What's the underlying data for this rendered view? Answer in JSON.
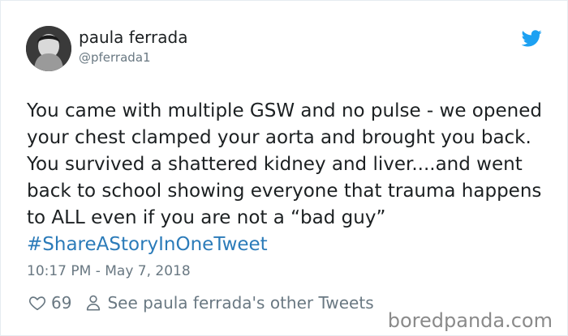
{
  "author": {
    "name": "paula ferrada",
    "handle": "@pferrada1"
  },
  "tweet": {
    "text": "You came with multiple GSW and no pulse - we opened your chest clamped your aorta and brought you back. You survived a shattered kidney and liver....and went back to school showing everyone that trauma happens to ALL even if you are not a “bad guy” ",
    "hashtag": "#ShareAStoryInOneTweet",
    "timestamp": "10:17 PM - May 7, 2018"
  },
  "actions": {
    "like_count": "69",
    "other_tweets_label": "See paula ferrada's other Tweets"
  },
  "watermark": "boredpanda.com",
  "colors": {
    "text": "#1c2022",
    "secondary": "#697882",
    "link": "#2b7bb9",
    "twitter_blue": "#1da1f2"
  },
  "icons": [
    "avatar",
    "twitter-bird-icon",
    "heart-icon",
    "person-icon"
  ]
}
